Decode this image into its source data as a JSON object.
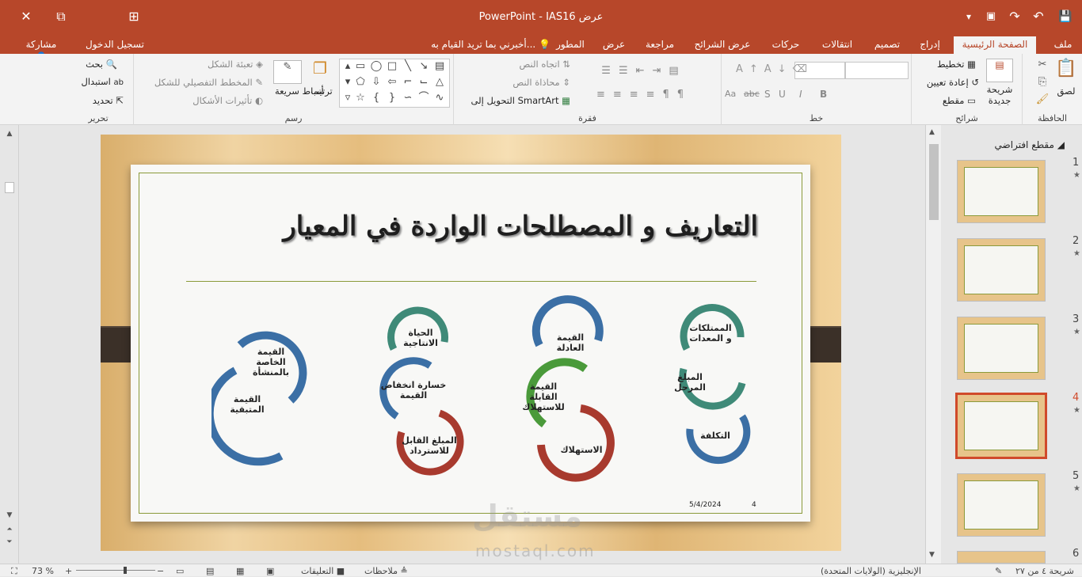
{
  "app": {
    "title": "PowerPoint - IAS16 عرض"
  },
  "titlebar": {
    "close_icon": "✕",
    "restore_icon": "⧉",
    "ribbon_display_icon": "⊞",
    "save_icon": "💾",
    "undo_icon": "↶",
    "redo_icon": "↷",
    "present_icon": "▣",
    "customize_icon": "▾"
  },
  "tabs": {
    "file": "ملف",
    "home": "الصفحة الرئيسية",
    "insert": "إدراج",
    "design": "تصميم",
    "transitions": "انتقالات",
    "animations": "حركات",
    "slideshow": "عرض الشرائح",
    "review": "مراجعة",
    "view": "عرض",
    "developer": "المطور",
    "tellme": "أخبرني بما تريد القيام به...",
    "signin": "تسجيل الدخول",
    "share": "مشاركة"
  },
  "ribbon": {
    "clipboard": {
      "label": "الحافظة",
      "paste": "لصق"
    },
    "slides": {
      "label": "شرائح",
      "new_slide": "شريحة جديدة",
      "layout": "تخطيط",
      "reset": "إعادة تعيين",
      "section": "مقطع"
    },
    "font": {
      "label": "خط",
      "bold": "B",
      "italic": "I",
      "underline": "U",
      "shadow": "S",
      "strike": "abc",
      "size_label": "Aa"
    },
    "paragraph": {
      "label": "فقرة",
      "text_direction": "اتجاه النص",
      "align_text": "محاذاة النص",
      "smartart": "التحويل إلى SmartArt"
    },
    "drawing": {
      "label": "رسم",
      "arrange": "ترتيب",
      "quick_styles": "أنماط سريعة",
      "shape_fill": "تعبئة الشكل",
      "shape_outline": "المخطط التفصيلي للشكل",
      "shape_effects": "تأثيرات الأشكال"
    },
    "editing": {
      "label": "تحرير",
      "find": "بحث",
      "replace": "استبدال",
      "select": "تحديد"
    }
  },
  "slide": {
    "title": "التعاريف و المصطلحات الواردة في المعيار",
    "date": "5/4/2024",
    "number": "4",
    "cycles": [
      {
        "labels": [
          "الممتلكات و المعدات",
          "المبلغ المرحل",
          "التكلفة"
        ],
        "colors": [
          "#3f8a78",
          "#3f8a78",
          "#3b6fa5"
        ]
      },
      {
        "labels": [
          "القيمة العادلة",
          "القيمة القابلة للاستهلاك",
          "الاستهلاك"
        ],
        "colors": [
          "#3b6fa5",
          "#4a9a3a",
          "#a83a2e"
        ]
      },
      {
        "labels": [
          "الحياة الانتاجية",
          "خسارة انخفاض القيمة",
          "المبلغ القابل للاسترداد"
        ],
        "colors": [
          "#3f8a78",
          "#3b6fa5",
          "#a83a2e"
        ]
      },
      {
        "labels": [
          "القيمة الخاصة بالمنشأة",
          "القيمة المتبقية",
          ""
        ],
        "colors": [
          "#3b6fa5",
          "#3b6fa5",
          "#3b6fa5"
        ]
      }
    ]
  },
  "thumbnails": {
    "section_label": "مقطع افتراضي",
    "items": [
      {
        "number": "1",
        "star": "★",
        "selected": false
      },
      {
        "number": "2",
        "star": "★",
        "selected": false
      },
      {
        "number": "3",
        "star": "★",
        "selected": false
      },
      {
        "number": "4",
        "star": "★",
        "selected": true
      },
      {
        "number": "5",
        "star": "★",
        "selected": false
      },
      {
        "number": "6",
        "star": "",
        "selected": false
      }
    ]
  },
  "statusbar": {
    "slide_info": "شريحة ٤ من ٢٧",
    "language": "الإنجليزية (الولايات المتحدة)",
    "notes": "ملاحظات",
    "comments": "التعليقات",
    "zoom": "73 %",
    "zoom_minus": "−",
    "zoom_plus": "+"
  },
  "watermark": {
    "text": "مستقل",
    "url": "mostaql.com"
  }
}
